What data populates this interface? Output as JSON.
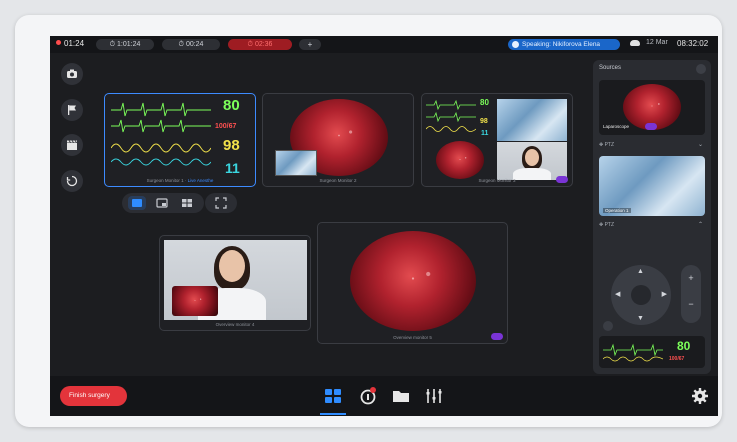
{
  "status_bar": {
    "recording_time": "01:24",
    "timers": [
      "1:01:24",
      "00:24",
      "02:36"
    ],
    "add_timer": "+",
    "speaking": "Speaking: Nikiforova Elena",
    "date": "12 Mar",
    "time": "08:32:02"
  },
  "tiles": [
    {
      "label": "Surgeon Monitor 1",
      "extra": "Live Anesthe"
    },
    {
      "label": "Surgeon Monitor 2"
    },
    {
      "label": "Surgeon Monitor 3"
    },
    {
      "label": "Overview monitor 4"
    },
    {
      "label": "Overview monitor 5"
    }
  ],
  "vitals": {
    "hr": "80",
    "bp": "100/67",
    "spo2": "98",
    "resp": "11"
  },
  "sources_panel": {
    "title": "Sources",
    "laparoscope_label": "Laparoscope",
    "ptz_label": "PTZ",
    "camera_label": "Operation 1",
    "mini_hr": "80",
    "mini_bp": "100/67"
  },
  "bottom_bar": {
    "finish_label": "Finish surgery"
  },
  "colors": {
    "accent": "#2f8cff",
    "danger": "#e3343b",
    "tag": "#7a34d6",
    "vital_green": "#7cff5a",
    "vital_yellow": "#f2e24b",
    "vital_cyan": "#3ad6e0",
    "vital_red": "#ff5050"
  }
}
